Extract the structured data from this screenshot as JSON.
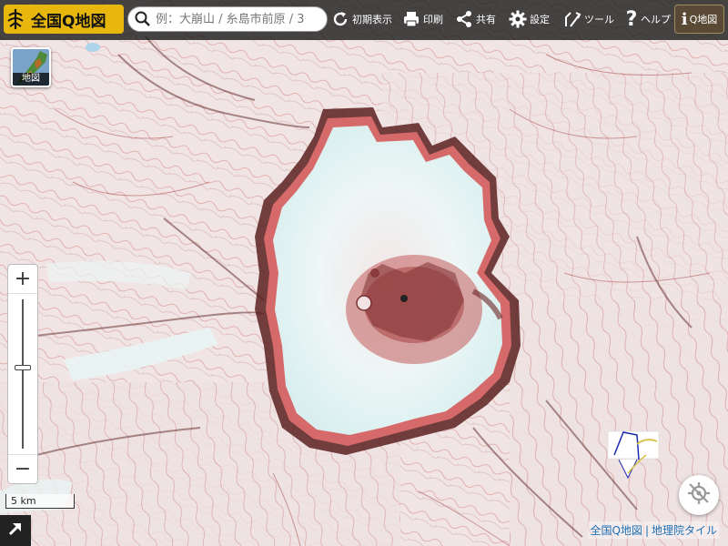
{
  "app": {
    "title": "全国Q地図"
  },
  "search": {
    "placeholder": "例：大崩山 / 糸島市前原 / 3"
  },
  "toolbar": {
    "reset_label": "初期表示",
    "print_label": "印刷",
    "share_label": "共有",
    "settings_label": "設定",
    "tools_label": "ツール",
    "help_label": "ヘルプ",
    "q_label": "Q地図",
    "info_glyph": "i",
    "help_glyph": "?"
  },
  "basemap": {
    "label": "地図"
  },
  "zoom": {
    "in_label": "+",
    "out_label": "−"
  },
  "scale": {
    "label": "5 km"
  },
  "attribution": {
    "qmap": "全国Q地図",
    "separator": "|",
    "gsi": "地理院タイル"
  },
  "colors": {
    "accent": "#e7b70e",
    "toolbar_bg": "#141414",
    "relief_red": "#c62828",
    "caldera_floor": "#e6f4f3",
    "link": "#1d6fb5"
  },
  "icons": {
    "logo": "tree-icon",
    "search": "search-icon",
    "reset": "reset-icon",
    "print": "printer-icon",
    "share": "share-icon",
    "settings": "gear-icon",
    "tools": "tools-icon",
    "help": "question-icon",
    "info": "info-icon",
    "expand": "expand-arrow-icon",
    "locate": "location-disabled-icon"
  }
}
